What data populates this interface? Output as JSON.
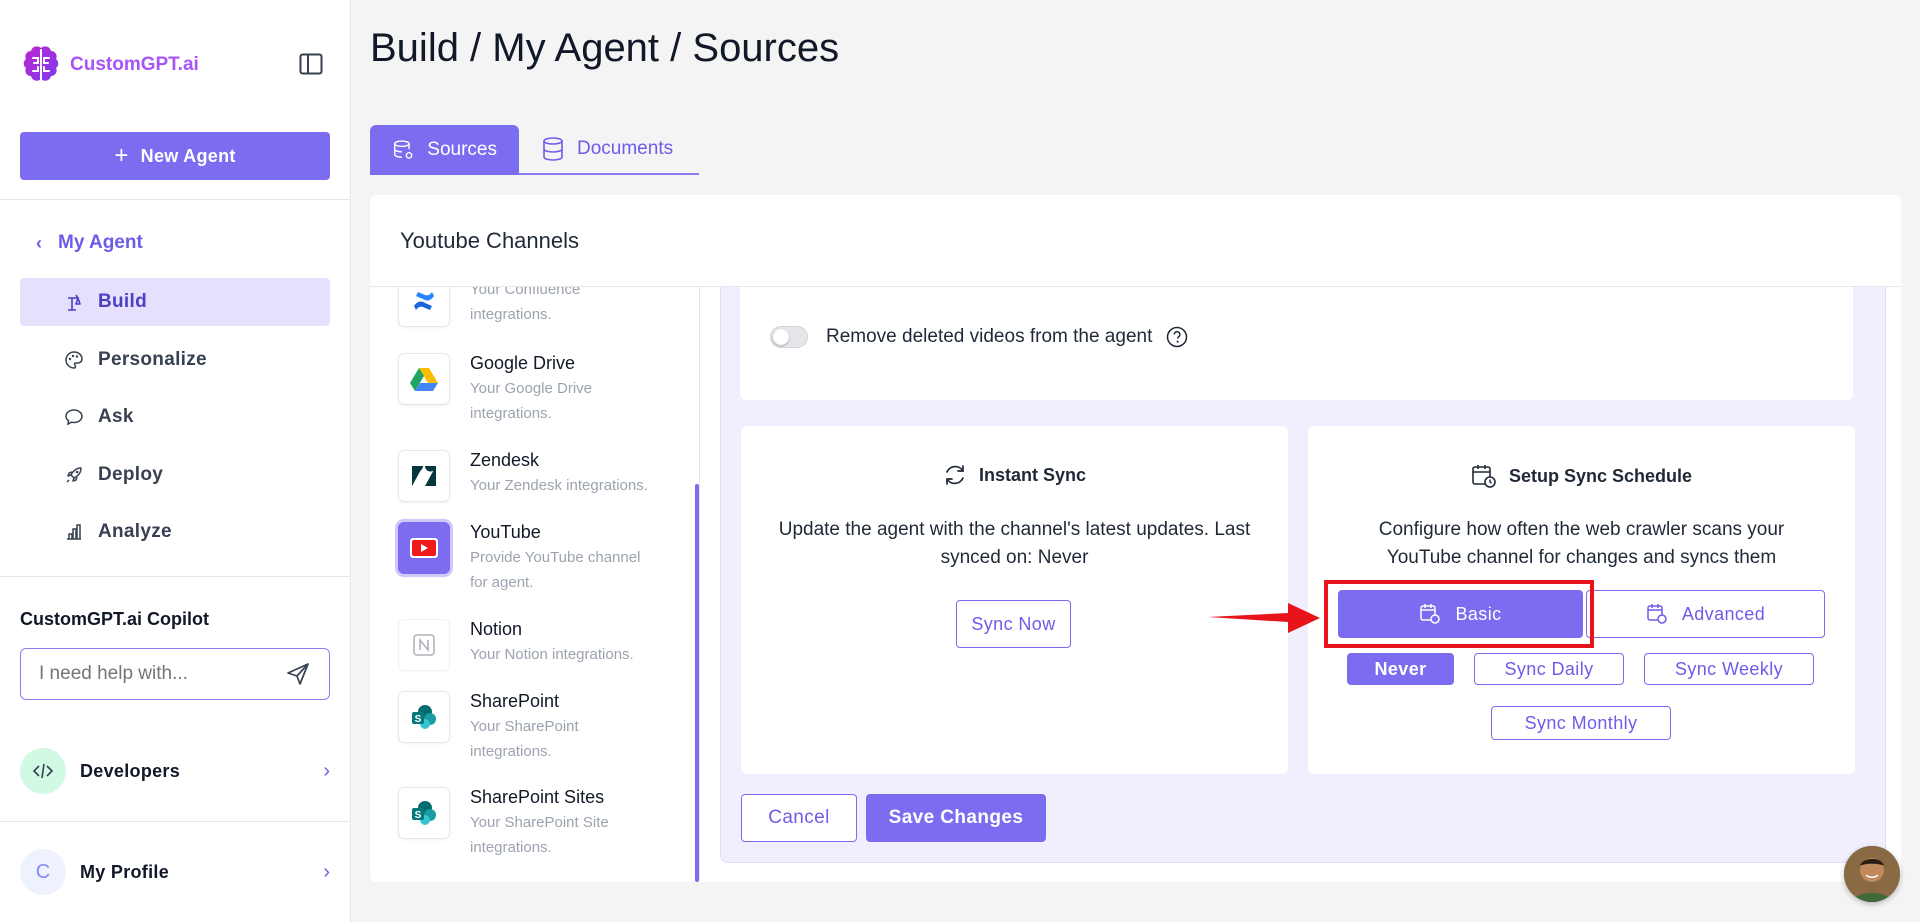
{
  "app": {
    "name": "CustomGPT.ai"
  },
  "sidebar": {
    "new_agent_label": "New Agent",
    "back_label": "My Agent",
    "nav": [
      {
        "label": "Build",
        "icon": "build-icon",
        "active": true
      },
      {
        "label": "Personalize",
        "icon": "palette-icon"
      },
      {
        "label": "Ask",
        "icon": "chat-icon"
      },
      {
        "label": "Deploy",
        "icon": "rocket-icon"
      },
      {
        "label": "Analyze",
        "icon": "chart-icon"
      }
    ],
    "copilot": {
      "title": "CustomGPT.ai Copilot",
      "placeholder": "I need help with..."
    },
    "developers_label": "Developers",
    "profile": {
      "initial": "C",
      "label": "My Profile"
    }
  },
  "header": {
    "title": "Build / My Agent / Sources"
  },
  "tabs": [
    {
      "label": "Sources",
      "active": true
    },
    {
      "label": "Documents"
    }
  ],
  "card": {
    "title": "Youtube Channels"
  },
  "integrations": [
    {
      "name": "",
      "desc1": "Your Confluence",
      "desc2": "integrations.",
      "icon": "confluence-icon"
    },
    {
      "name": "Google Drive",
      "desc1": "Your Google Drive",
      "desc2": "integrations.",
      "icon": "google-drive-icon"
    },
    {
      "name": "Zendesk",
      "desc1": "Your Zendesk integrations.",
      "desc2": "",
      "icon": "zendesk-icon"
    },
    {
      "name": "YouTube",
      "desc1": "Provide YouTube channel",
      "desc2": "for agent.",
      "icon": "youtube-icon",
      "active": true
    },
    {
      "name": "Notion",
      "desc1": "Your Notion integrations.",
      "desc2": "",
      "icon": "notion-icon"
    },
    {
      "name": "SharePoint",
      "desc1": "Your SharePoint",
      "desc2": "integrations.",
      "icon": "sharepoint-icon"
    },
    {
      "name": "SharePoint Sites",
      "desc1": "Your SharePoint Site",
      "desc2": "integrations.",
      "icon": "sharepoint-sites-icon"
    }
  ],
  "settings": {
    "remove_deleted_label": "Remove deleted videos from the agent",
    "remove_deleted_enabled": false
  },
  "instant_sync": {
    "title": "Instant Sync",
    "desc_line1": "Update the agent with the channel's latest updates. Last",
    "desc_line2": "synced on: Never",
    "button": "Sync Now"
  },
  "schedule": {
    "title": "Setup Sync Schedule",
    "desc_line1": "Configure how often the web crawler scans your",
    "desc_line2": "YouTube channel for changes and syncs them",
    "modes": [
      {
        "label": "Basic",
        "active": true
      },
      {
        "label": "Advanced"
      }
    ],
    "frequencies": [
      {
        "label": "Never",
        "active": true
      },
      {
        "label": "Sync Daily"
      },
      {
        "label": "Sync Weekly"
      },
      {
        "label": "Sync Monthly"
      }
    ]
  },
  "actions": {
    "cancel": "Cancel",
    "save": "Save Changes"
  },
  "colors": {
    "accent": "#7c6cf0",
    "accent_light": "#e5e1fc",
    "highlight": "#e8141b"
  }
}
